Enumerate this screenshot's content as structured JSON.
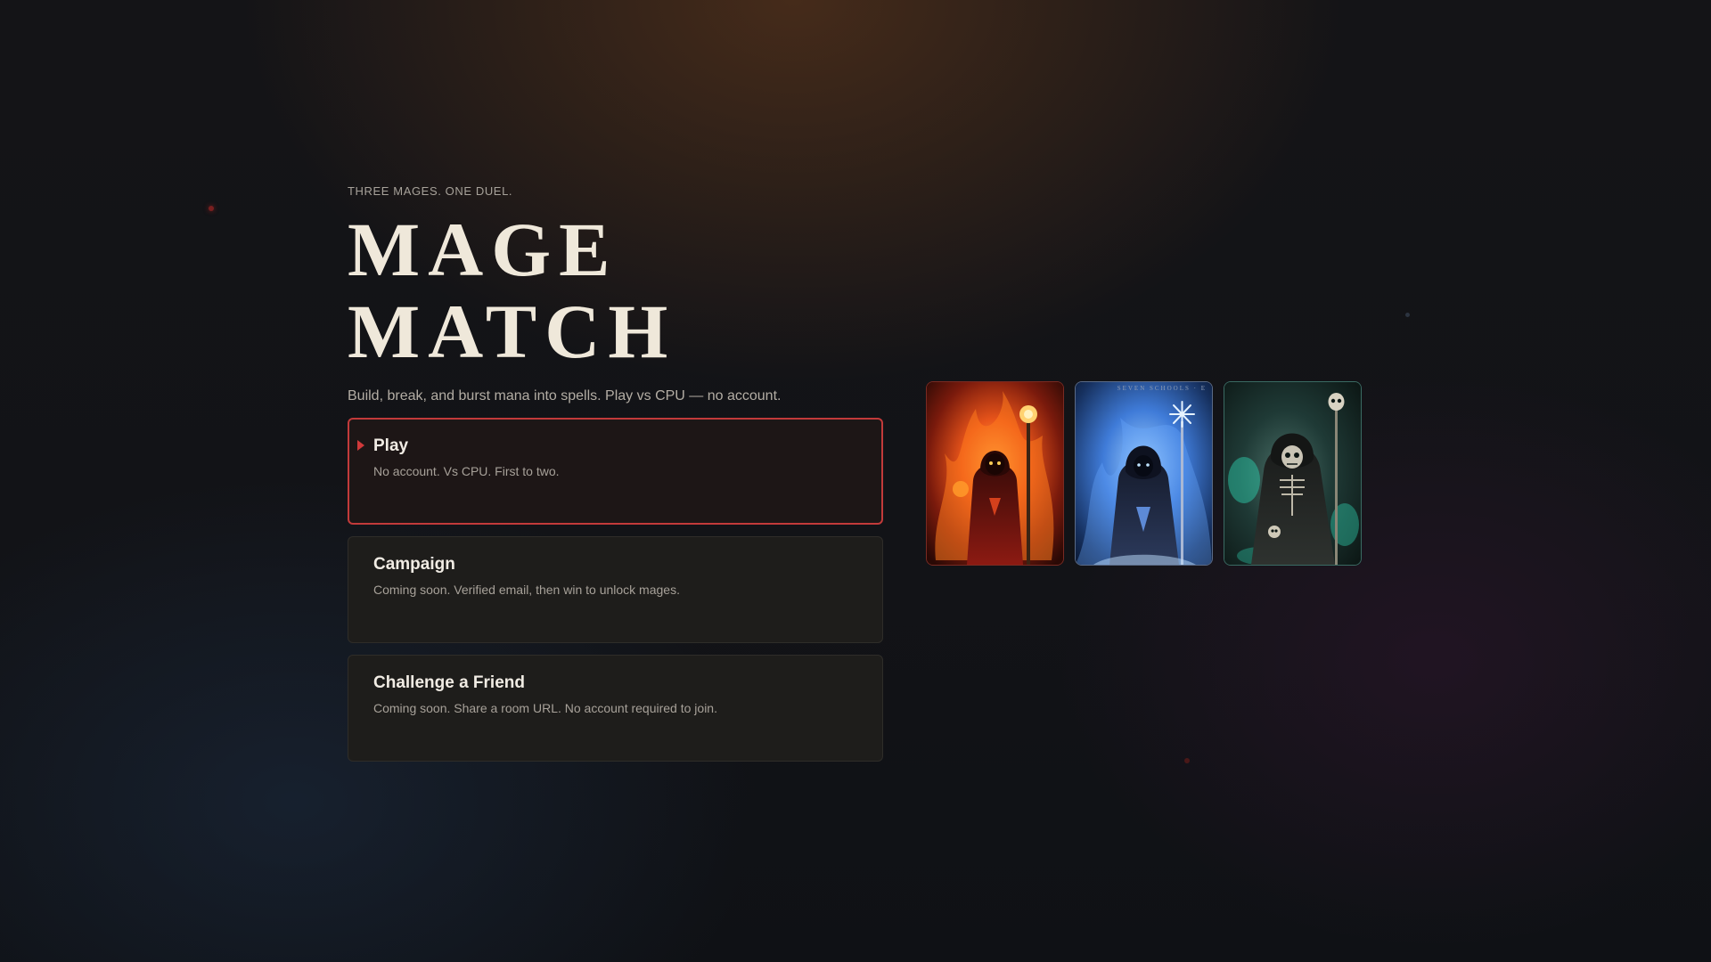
{
  "hero": {
    "eyebrow": "THREE MAGES. ONE DUEL.",
    "title_line1": "MAGE",
    "title_line2": "MATCH",
    "tagline": "Build, break, and burst mana into spells. Play vs CPU — no account."
  },
  "menu": [
    {
      "label": "Play",
      "desc": "No account. Vs CPU. First to two.",
      "selected": true
    },
    {
      "label": "Campaign",
      "desc": "Coming soon. Verified email, then win to unlock mages.",
      "selected": false
    },
    {
      "label": "Challenge a Friend",
      "desc": "Coming soon. Share a room URL. No account required to join.",
      "selected": false
    }
  ],
  "mage_cards": [
    {
      "icon": "fire-mage-card-art",
      "accent": "#e8541a"
    },
    {
      "icon": "frost-mage-card-art",
      "accent": "#6fa8ff",
      "inscription": "SEVEN SCHOOLS · E"
    },
    {
      "icon": "necromancer-card-art",
      "accent": "#2fd6b4"
    }
  ],
  "colors": {
    "accent_red": "#c23a3a",
    "title": "#efe8da",
    "card_bg": "#1e1d1b"
  }
}
